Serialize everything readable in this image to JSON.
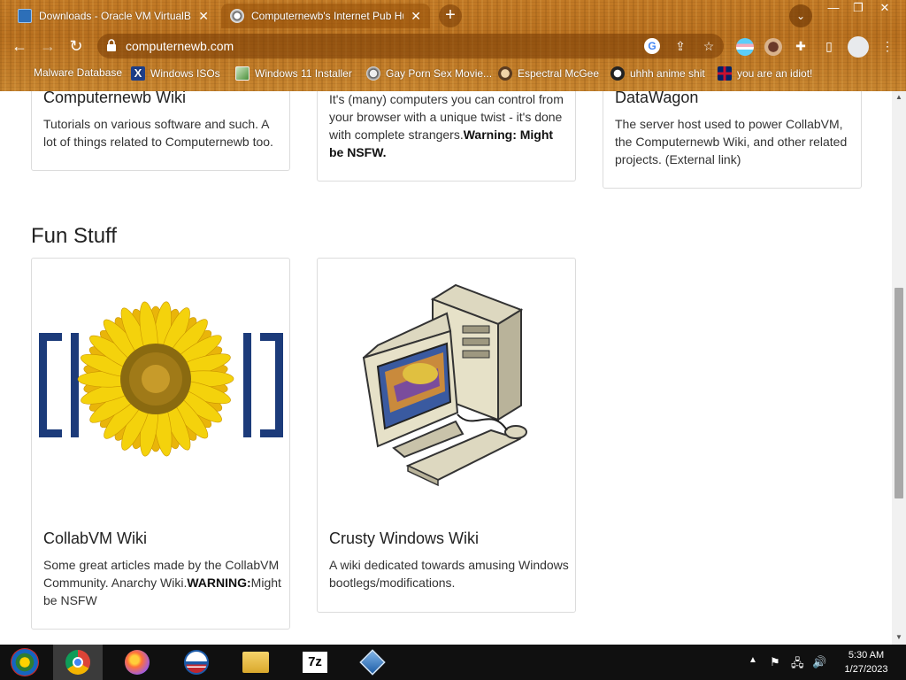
{
  "browser": {
    "tabs": [
      {
        "title": "Downloads - Oracle VM VirtualBox",
        "active": false,
        "icon": "virtualbox-icon"
      },
      {
        "title": "Computernewb's Internet Pub Hub",
        "active": true,
        "icon": "computernewb-icon"
      }
    ],
    "new_tab_label": "+",
    "url": "computernewb.com",
    "bookmarks": [
      {
        "label": "Malware Database",
        "icon": "none"
      },
      {
        "label": "Windows ISOs",
        "icon": "x-icon"
      },
      {
        "label": "Windows 11 Installer",
        "icon": "image-icon"
      },
      {
        "label": "Gay Porn Sex Movie...",
        "icon": "globe-icon"
      },
      {
        "label": "Espectral McGee",
        "icon": "avatar-icon"
      },
      {
        "label": "uhhh anime shit",
        "icon": "anime-icon"
      },
      {
        "label": "you are an idiot!",
        "icon": "flag-icon"
      }
    ]
  },
  "page": {
    "top_cards": [
      {
        "title": "Computernewb Wiki",
        "text": "Tutorials on various software and such. A lot of things related to Computernewb too.",
        "bold": ""
      },
      {
        "title": "",
        "text": "It's (many) computers you can control from your browser with a unique twist - it's done with complete strangers.",
        "bold": "Warning: Might be NSFW."
      },
      {
        "title": "DataWagon",
        "text": "The server host used to power CollabVM, the Computernewb Wiki, and other related projects. (External link)",
        "bold": ""
      }
    ],
    "section_title": "Fun Stuff",
    "fun_cards": [
      {
        "title": "CollabVM Wiki",
        "text_before": "Some great articles made by the CollabVM Community. Anarchy Wiki.",
        "bold": "WARNING:",
        "text_after": "Might be NSFW"
      },
      {
        "title": "Crusty Windows Wiki",
        "text_before": "A wiki dedicated towards amusing Windows bootlegs/modifications.",
        "bold": "",
        "text_after": ""
      }
    ]
  },
  "taskbar": {
    "apps": [
      "start-button",
      "chrome",
      "firefox",
      "obama",
      "file-explorer",
      "7zip",
      "virtualbox"
    ],
    "time": "5:30 AM",
    "date": "1/27/2023"
  }
}
